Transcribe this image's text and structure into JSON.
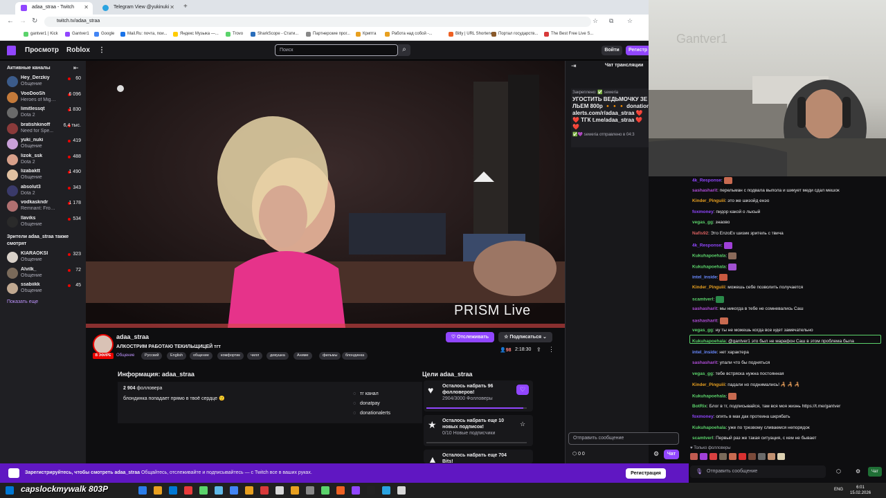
{
  "browser": {
    "tabs": [
      {
        "title": "adaa_straa - Twitch"
      },
      {
        "title": "Telegram View @yukinuki"
      }
    ],
    "url": "twitch.tv/adaa_straa",
    "bookmarks": [
      "gantver1 | Kick",
      "Gantver1",
      "Google",
      "Mail.Ru: почта, пои...",
      "Яндекс Музыка —...",
      "Trovo",
      "SharkScope - Стати...",
      "Партнерские прог...",
      "Крипта",
      "Работа над собой -...",
      "Bitly | URL Shortene...",
      "Портал государств...",
      "The Best Free Live S..."
    ]
  },
  "twitch_nav": {
    "browse": "Просмотр",
    "roblox": "Roblox",
    "search_placeholder": "Поиск",
    "login": "Войти",
    "signup": "Регистр"
  },
  "sidebar": {
    "title": "Активные каналы",
    "channels": [
      {
        "name": "Hey_Derzkiy",
        "game": "Общение",
        "viewers": "60",
        "color": "#3b5b8a"
      },
      {
        "name": "VooDooSh",
        "game": "Heroes of Might...",
        "viewers": "6 096",
        "color": "#c47a3a"
      },
      {
        "name": "limitlessqt",
        "game": "Dota 2",
        "viewers": "1 830",
        "color": "#6a6a6a"
      },
      {
        "name": "bratishkinoff",
        "game": "Need for Spe...",
        "viewers": "6,4 тыс.",
        "color": "#8a3a3a"
      },
      {
        "name": "yuki_nuki",
        "game": "Общение",
        "viewers": "419",
        "color": "#c9a0d8"
      },
      {
        "name": "lizok_ssk",
        "game": "Dota 2",
        "viewers": "488",
        "color": "#d8a08a"
      },
      {
        "name": "lizabaktt",
        "game": "Общение",
        "viewers": "1 490",
        "color": "#e0c0a0"
      },
      {
        "name": "absolut3",
        "game": "Dota 2",
        "viewers": "343",
        "color": "#3a3a6a"
      },
      {
        "name": "vodkaskndr",
        "game": "Remnant: From t...",
        "viewers": "1 178",
        "color": "#b07070"
      },
      {
        "name": "llaviks",
        "game": "Общение",
        "viewers": "534",
        "color": "#2a2a2a"
      }
    ],
    "recommended_title": "Зрители adaa_straa также смотрят",
    "recommended": [
      {
        "name": "KIARAOKSI",
        "game": "Общение",
        "viewers": "323",
        "color": "#d8d0c8"
      },
      {
        "name": "Alvilk_",
        "game": "Общение",
        "viewers": "72",
        "color": "#7a6a5a"
      },
      {
        "name": "ssabiikk",
        "game": "Общение",
        "viewers": "45",
        "color": "#c0a890"
      }
    ],
    "show_more": "Показать еще"
  },
  "player": {
    "watermark": "PRISM Live"
  },
  "channel": {
    "name": "adaa_straa",
    "live_badge": "В ЭФИРЕ",
    "title": "АЛКОСТРИМ РАБОТАЮ ТЕКИЛЬЩИЦЕЙ тгт",
    "category": "Общение",
    "tags": [
      "Русский",
      "English",
      "общение",
      "комфортик",
      "чилл",
      "девушка",
      "Аниме",
      "фильмы",
      "блондинка"
    ],
    "follow_label": "Отслеживать",
    "subscribe_label": "Подписаться",
    "viewers": "98",
    "uptime": "2:18:30"
  },
  "about": {
    "title": "Информация: adaa_straa",
    "followers_count": "2 904",
    "followers_label": "фолловера",
    "description": "блондинка попадает прямо в твоё сердце 🙂",
    "links": [
      "тг канал",
      "donatpay",
      "donationalerts"
    ]
  },
  "goals": {
    "title": "Цели adaa_straa",
    "items": [
      {
        "title": "Осталось набрать 96 фолловеров!",
        "progress": "2904/3000 Фолловеры",
        "fraction": 0.968
      },
      {
        "title": "Осталось набрать еще 10 новых подписок!",
        "progress": "0/10 Новые подписчики",
        "fraction": 0.0
      },
      {
        "title": "Осталось набрать еще 704 Bits!",
        "progress": "",
        "fraction": 0.3
      }
    ]
  },
  "chat": {
    "header": "Чат трансляции",
    "pinned_label": "Закреплено: ✅ seweria",
    "pinned_text": "УГОСТИТЬ ВЕДЬМОЧКУ ЗЕЛЬЕМ 800р 🔸🔸🔸 donationalerts.com/r/adaa_straa ❤️ ❤️ ТГК t.me/adaa_straa ❤️ ❤️",
    "pinned_footer": "✅💜 seweria отправлено в 04:3",
    "input_placeholder": "Отправить сообщение",
    "points": "0   0",
    "send_label": "Чат"
  },
  "webcam": {
    "wall_text": "Gantver1"
  },
  "overlay_chat": {
    "messages": [
      {
        "user": "4k_Response",
        "color": "#9146ff",
        "text": ""
      },
      {
        "user": "sashasharit",
        "color": "#b04dd8",
        "text": "перельман с подвала выпола и шикует меди сдал мешок"
      },
      {
        "user": "Kinder_Pinguiii",
        "color": "#e8a020",
        "text": "это же шизойд енэо"
      },
      {
        "user": "foxmoney",
        "color": "#9146ff",
        "text": "пидор какой о лысый"
      },
      {
        "user": "vegas_gg",
        "color": "#5bd36b",
        "text": "знаово"
      },
      {
        "user": "Nafis92",
        "color": "#d86060",
        "text": "Это EnzoEv шизик зритель с твича"
      },
      {
        "user": "4k_Response",
        "color": "#9146ff",
        "text": ""
      },
      {
        "user": "Kukuhapoehala",
        "color": "#5bd36b",
        "text": ""
      },
      {
        "user": "Kukuhapoehala",
        "color": "#5bd36b",
        "text": ""
      },
      {
        "user": "intel_inside",
        "color": "#6a8aff",
        "text": ""
      },
      {
        "user": "Kinder_Pinguiii",
        "color": "#e8a020",
        "text": "можешь себе позволить получается"
      },
      {
        "user": "scamtverl",
        "color": "#5bd36b",
        "text": ""
      },
      {
        "user": "sashasharit",
        "color": "#b04dd8",
        "text": "мы никогда в тебе не сомневались Саш"
      },
      {
        "user": "sashasharit",
        "color": "#b04dd8",
        "text": ""
      },
      {
        "user": "vegas_gg",
        "color": "#5bd36b",
        "text": "ну ты не можешь когда все идет замечательно"
      },
      {
        "user": "Kukuhapoehala",
        "color": "#5bd36b",
        "text": "@gantver1 это был не марафон Саш в этом проблема была"
      },
      {
        "user": "intel_inside",
        "color": "#6a8aff",
        "text": "нет характера"
      },
      {
        "user": "sashasharit",
        "color": "#b04dd8",
        "text": "упали что бы подняться"
      },
      {
        "user": "vegas_gg",
        "color": "#5bd36b",
        "text": "тебе встряска нужна постоянная"
      },
      {
        "user": "Kinder_Pinguiii",
        "color": "#e8a020",
        "text": "падали но поднимались! 🦂 🦂 🦂"
      },
      {
        "user": "Kukuhapoehala",
        "color": "#5bd36b",
        "text": ""
      },
      {
        "user": "BotRix",
        "color": "#5bd36b",
        "text": "Блог в тг, подписывайся, там вся моя жизнь https://t.me/gantver"
      },
      {
        "user": "foxmoney",
        "color": "#9146ff",
        "text": "опять в мак дак протеина шкрябать"
      },
      {
        "user": "Kukuhapoehala",
        "color": "#5bd36b",
        "text": "уже по трезвому сливаемся непорядок"
      },
      {
        "user": "scamtverl",
        "color": "#5bd36b",
        "text": "Первый раз же такая ситуация, с кем не бывает"
      }
    ],
    "followers_only": "Только фолловеры",
    "input_placeholder": "Отправить сообщение",
    "send_label": "Чат"
  },
  "signup_banner": {
    "prefix": "Зарегистрируйтесь, чтобы смотреть adaa_straa",
    "text": "Общайтесь, отслеживайте и подписывайтесь — с Twitch все в ваших руках.",
    "button": "Регистрация"
  },
  "taskbar": {
    "overlay_text": "capslockmywalk 803P",
    "lang": "ENG",
    "time": "6:01",
    "date": "15.02.2026"
  },
  "colors": {
    "twitch_purple": "#9146ff",
    "live_red": "#eb0400",
    "banner": "#6017c2"
  }
}
